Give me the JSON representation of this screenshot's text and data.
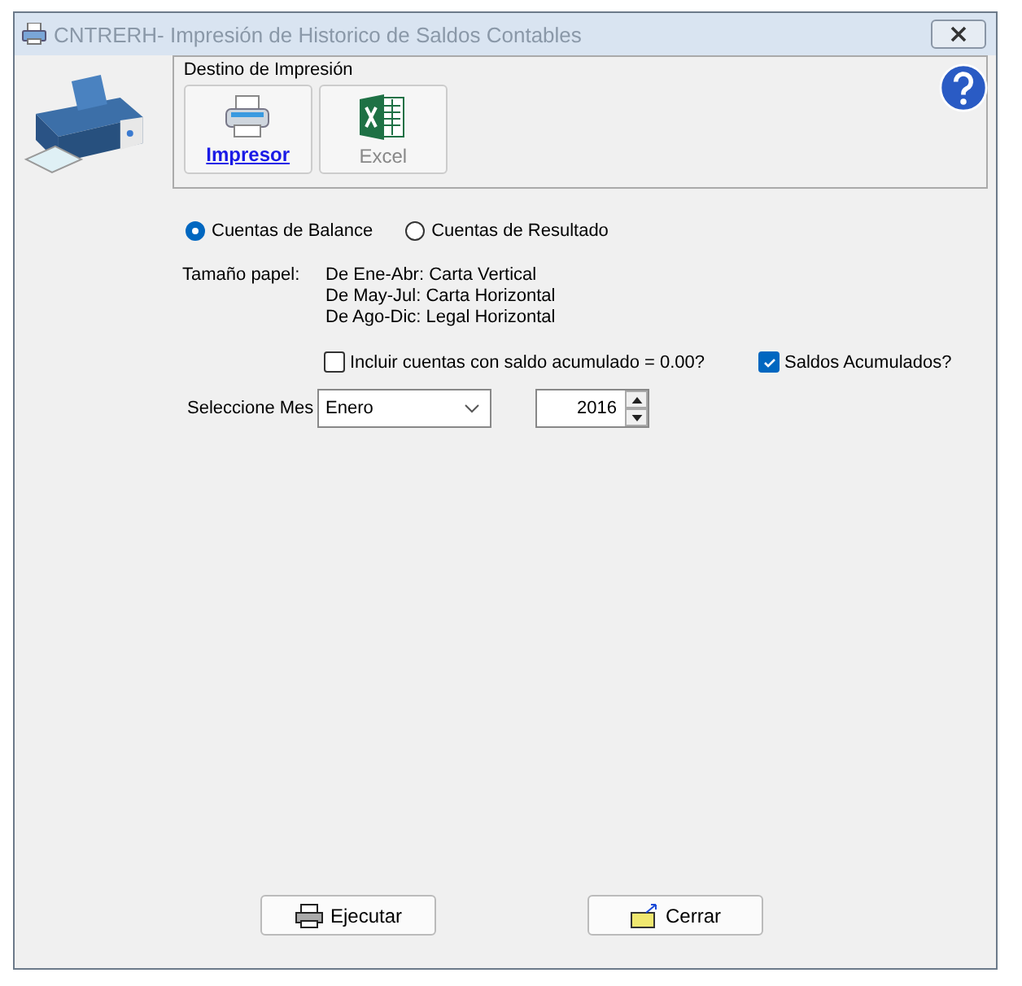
{
  "window": {
    "title": "CNTRERH- Impresión de Historico de Saldos Contables"
  },
  "destination": {
    "title": "Destino de Impresión",
    "options": [
      {
        "label": "Impresor",
        "kind": "printer",
        "selected": true
      },
      {
        "label": "Excel",
        "kind": "excel",
        "selected": false
      }
    ]
  },
  "report_type": [
    {
      "label": "Cuentas de Balance",
      "selected": true
    },
    {
      "label": "Cuentas de Resultado",
      "selected": false
    }
  ],
  "paper_size": {
    "label": "Tamaño papel:",
    "lines": [
      "De Ene-Abr: Carta Vertical",
      "De May-Jul: Carta Horizontal",
      "De Ago-Dic: Legal Horizontal"
    ]
  },
  "checkboxes": [
    {
      "label": "Incluir cuentas con saldo acumulado = 0.00?",
      "checked": false
    },
    {
      "label": "Saldos Acumulados?",
      "checked": true
    }
  ],
  "month": {
    "label": "Seleccione Mes",
    "value": "Enero"
  },
  "year": {
    "value": "2016"
  },
  "buttons": [
    {
      "label": "Ejecutar",
      "kind": "print"
    },
    {
      "label": "Cerrar",
      "kind": "close"
    }
  ]
}
